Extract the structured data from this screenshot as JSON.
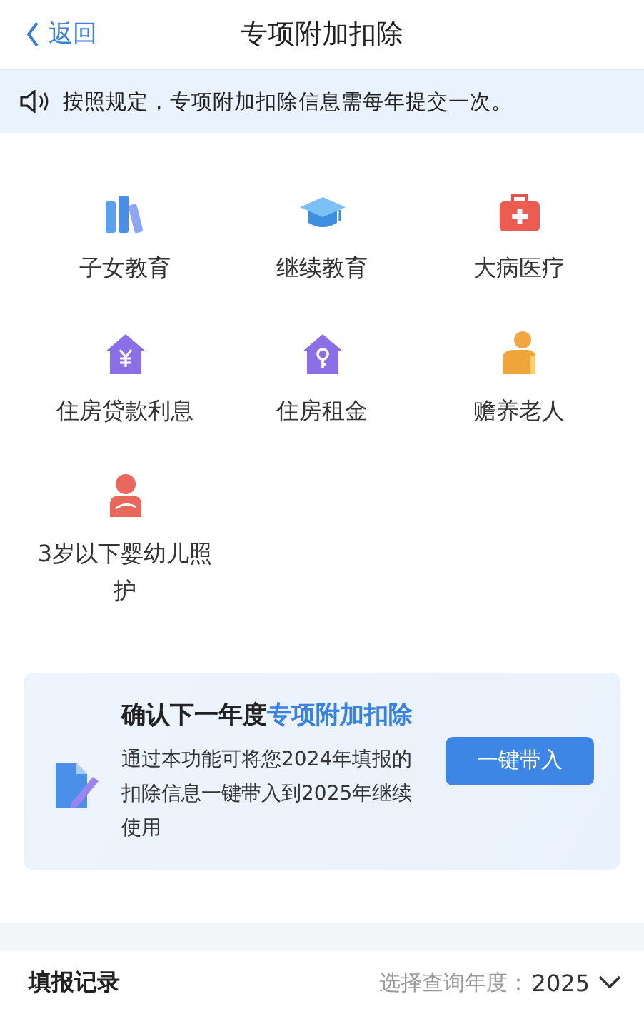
{
  "nav": {
    "back": "返回",
    "title": "专项附加扣除"
  },
  "notice": {
    "text": "按照规定，专项附加扣除信息需每年提交一次。"
  },
  "categories": [
    {
      "label": "子女教育",
      "kind": "books"
    },
    {
      "label": "继续教育",
      "kind": "cap"
    },
    {
      "label": "大病医疗",
      "kind": "medkit"
    },
    {
      "label": "住房贷款利息",
      "kind": "house_yen"
    },
    {
      "label": "住房租金",
      "kind": "house_key"
    },
    {
      "label": "赡养老人",
      "kind": "elder"
    },
    {
      "label": "3岁以下婴幼儿照护",
      "kind": "infant"
    }
  ],
  "carry_card": {
    "title": "确认下一年度**专项附加扣除**",
    "description": "通过本功能可将您2024年填报的扣除信息一键带入到2025年继续使用",
    "button": "一键带入"
  },
  "records": {
    "title": "填报记录",
    "year_label": "选择查询年度：",
    "year": "2025"
  }
}
